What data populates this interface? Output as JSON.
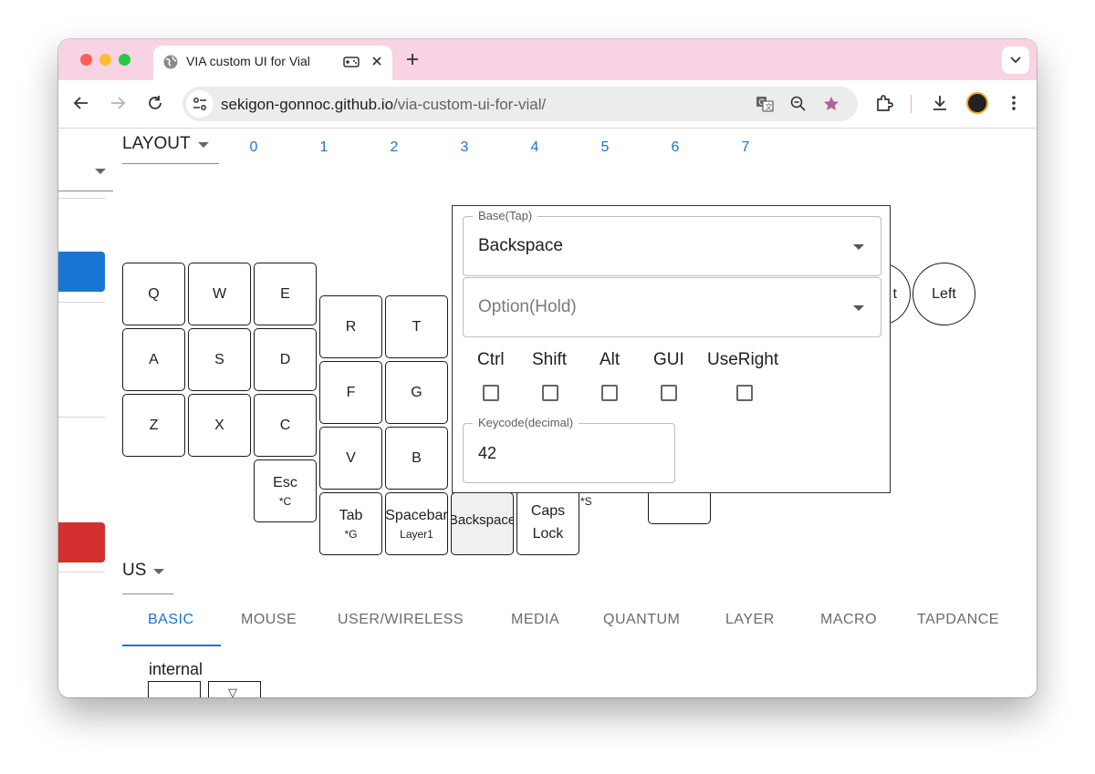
{
  "browser": {
    "tab_title": "VIA custom UI for Vial",
    "url_host": "sekigon-gonnoc.github.io",
    "url_path": "/via-custom-ui-for-vial/"
  },
  "layout_select": {
    "label": "LAYOUT"
  },
  "layers": [
    "0",
    "1",
    "2",
    "3",
    "4",
    "5",
    "6",
    "7"
  ],
  "keys": {
    "q": "Q",
    "w": "W",
    "e": "E",
    "r": "R",
    "t": "T",
    "a": "A",
    "s": "S",
    "d": "D",
    "f": "F",
    "g": "G",
    "z": "Z",
    "x": "X",
    "c": "C",
    "v": "V",
    "b": "B",
    "esc": {
      "label": "Esc",
      "sub": "*C"
    },
    "tab": {
      "label": "Tab",
      "sub": "*G"
    },
    "spacebar": {
      "label": "Spacebar",
      "sub": "Layer1"
    },
    "backspace": {
      "label": "Backspace"
    },
    "capslock": {
      "label": "Caps Lock"
    },
    "partial_right": "t",
    "left": "Left",
    "partial_sub": "*S"
  },
  "popup": {
    "base_legend": "Base(Tap)",
    "base_value": "Backspace",
    "option_placeholder": "Option(Hold)",
    "modifiers": [
      "Ctrl",
      "Shift",
      "Alt",
      "GUI",
      "UseRight"
    ],
    "keycode_legend": "Keycode(decimal)",
    "keycode_value": "42"
  },
  "lang_select": {
    "label": "US"
  },
  "category_tabs": [
    "BASIC",
    "MOUSE",
    "USER/WIRELESS",
    "MEDIA",
    "QUANTUM",
    "LAYER",
    "MACRO",
    "TAPDANCE"
  ],
  "active_category": "BASIC",
  "internal_label": "internal",
  "internal_keys": [
    "",
    "▽"
  ],
  "colors": {
    "accent": "#1976d2",
    "danger": "#d32f2f",
    "tabstrip": "#f7d3e4"
  }
}
